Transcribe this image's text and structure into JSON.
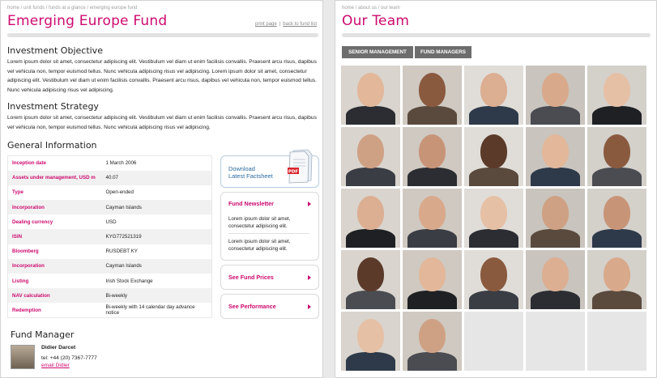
{
  "left": {
    "breadcrumb": "home / unit funds / funds at a glance / emerging europe fund",
    "title": "Emerging Europe Fund",
    "links": {
      "print": "print page",
      "separator": "|",
      "back": "back to fund list"
    },
    "objective": {
      "heading": "Investment Objective",
      "text": "Lorem ipsum dolor sit amet, consectetur adipiscing elit. Vestibulum vel diam ut enim facilisis convallis. Praesent arcu risus, dapibus vel vehicula non, tempor euismod tellus. Nunc vehicula adipiscing risus vel adipiscing. Lorem ipsum dolor sit amet, consectetur adipiscing elit. Vestibulum vel diam ut enim facilisis convallis. Praesent arcu risus, dapibus vel vehicula non, tempor euismod tellus. Nunc vehicula adipiscing risus vel adipiscing."
    },
    "strategy": {
      "heading": "Investment Strategy",
      "text": "Lorem ipsum dolor sit amet, consectetur adipiscing elit. Vestibulum vel diam ut enim facilisis convallis. Praesent arcu risus, dapibus vel vehicula non, tempor euismod tellus. Nunc vehicula adipiscing risus vel adipiscing."
    },
    "general": {
      "heading": "General Information",
      "rows": [
        {
          "label": "Inception date",
          "value": "1 March 2006"
        },
        {
          "label": "Assets under management, USD m",
          "value": "40.07"
        },
        {
          "label": "Type",
          "value": "Open-ended"
        },
        {
          "label": "Incorporation",
          "value": "Cayman Islands"
        },
        {
          "label": "Dealing currency",
          "value": "USD"
        },
        {
          "label": "ISIN",
          "value": "KYG772521319"
        },
        {
          "label": "Bloomberg",
          "value": "RUSDEBT KY"
        },
        {
          "label": "Incorporation",
          "value": "Cayman Islands"
        },
        {
          "label": "Listing",
          "value": "Irish Stock Exchange"
        },
        {
          "label": "NAV calculation",
          "value": "Bi-weekly"
        },
        {
          "label": "Redemption",
          "value": "Bi-weekly with 14 calendar day advance notice"
        }
      ]
    },
    "factsheet": {
      "line1": "Download",
      "line2": "Latest Factsheet",
      "icon": "pdf-document-icon"
    },
    "newsletter": {
      "title": "Fund Newsletter",
      "items": [
        "Lorem ipsum dolor sit amet, consectetur adipiscing elit.",
        "Lorem ipsum dolor sit amet, consectetur adipiscing elit."
      ]
    },
    "prices_link": "See Fund Prices",
    "performance_link": "See Performance",
    "manager": {
      "heading": "Fund Manager",
      "name": "Didier Darcet",
      "tel": "tel: +44 (20) 7367-7777",
      "email": "email Didier"
    },
    "accent": "#cc0a6e"
  },
  "right": {
    "breadcrumb": "home / about us / our team",
    "title": "Our Team",
    "tabs": [
      "SENIOR MANAGEMENT",
      "FUND MANAGERS"
    ],
    "photo_count": 22,
    "empty_count": 3
  }
}
